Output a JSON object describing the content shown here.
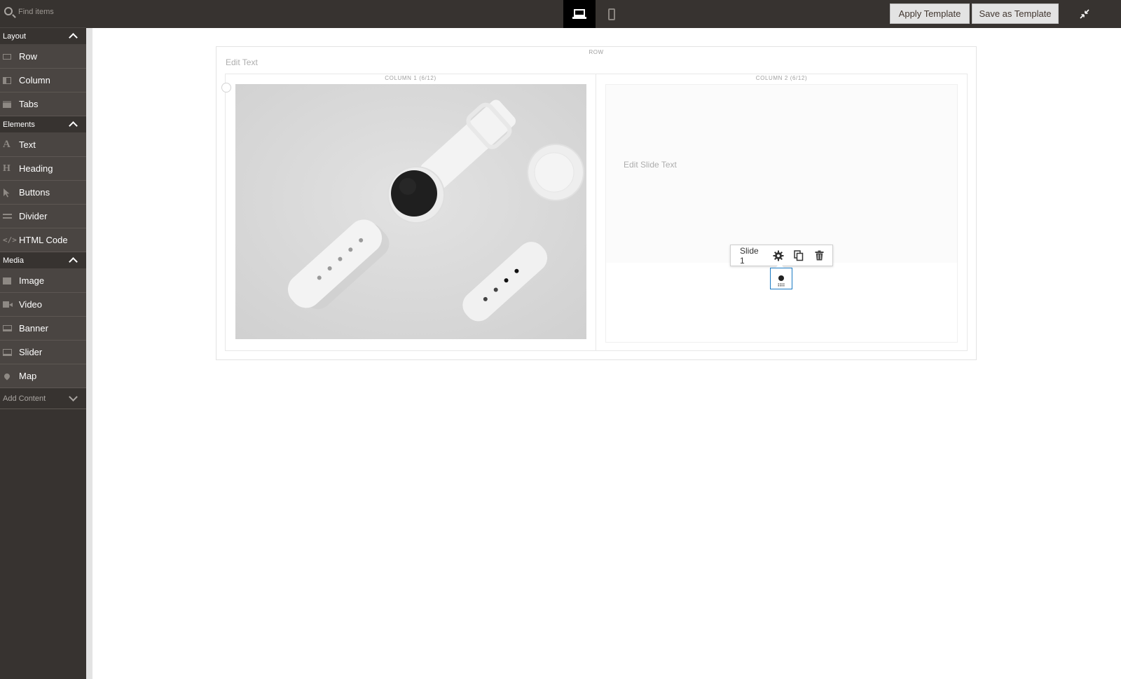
{
  "search": {
    "placeholder": "Find items"
  },
  "toolbar_top": {
    "apply_template_label": "Apply Template",
    "save_template_label": "Save as Template"
  },
  "sidebar": {
    "sections": [
      {
        "title": "Layout",
        "items": [
          "Row",
          "Column",
          "Tabs"
        ]
      },
      {
        "title": "Elements",
        "items": [
          "Text",
          "Heading",
          "Buttons",
          "Divider",
          "HTML Code"
        ]
      },
      {
        "title": "Media",
        "items": [
          "Image",
          "Video",
          "Banner",
          "Slider",
          "Map"
        ]
      }
    ],
    "add_content_label": "Add Content"
  },
  "stage": {
    "row_label": "ROW",
    "edit_text_placeholder": "Edit Text",
    "column1_label": "COLUMN 1 (6/12)",
    "column2_label": "COLUMN 2 (6/12)",
    "slide_text_placeholder": "Edit Slide Text",
    "slide_toolbar_label": "Slide 1"
  },
  "colors": {
    "chrome_dark": "#373330",
    "sidebar_item": "#4a4542",
    "active_device": "#000000",
    "focus_border": "#1979c3"
  },
  "icons": {
    "device_active": "laptop-icon",
    "device_other": "mobile-phone-icon",
    "toolbar": [
      "gear-icon",
      "duplicate-icon",
      "trash-icon"
    ]
  }
}
